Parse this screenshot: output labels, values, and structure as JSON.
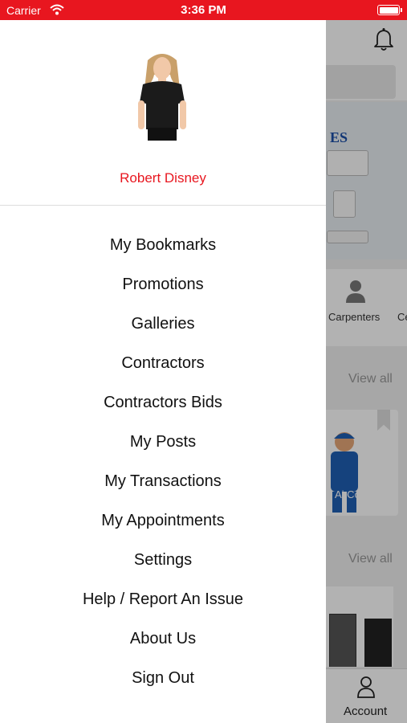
{
  "status_bar": {
    "carrier": "Carrier",
    "time": "3:36 PM"
  },
  "background_app": {
    "banner_brand": "ES",
    "categories": [
      "Carpenters",
      "Ce"
    ],
    "view_all_1": "View all",
    "card_caption": "in Ai Co...",
    "view_all_2": "View all",
    "tab_account": "Account"
  },
  "drawer": {
    "profile_name": "Robert Disney",
    "menu": [
      "My Bookmarks",
      "Promotions",
      "Galleries",
      "Contractors",
      "Contractors Bids",
      "My Posts",
      "My Transactions",
      "My Appointments",
      "Settings",
      "Help / Report An Issue",
      "About Us",
      "Sign Out"
    ]
  },
  "colors": {
    "accent": "#e8161f",
    "text": "#111111",
    "overlay": "rgba(0,0,0,0.30)"
  },
  "icons": [
    "wifi-icon",
    "battery-icon",
    "bell-icon",
    "person-icon",
    "bookmark-icon",
    "account-icon"
  ]
}
